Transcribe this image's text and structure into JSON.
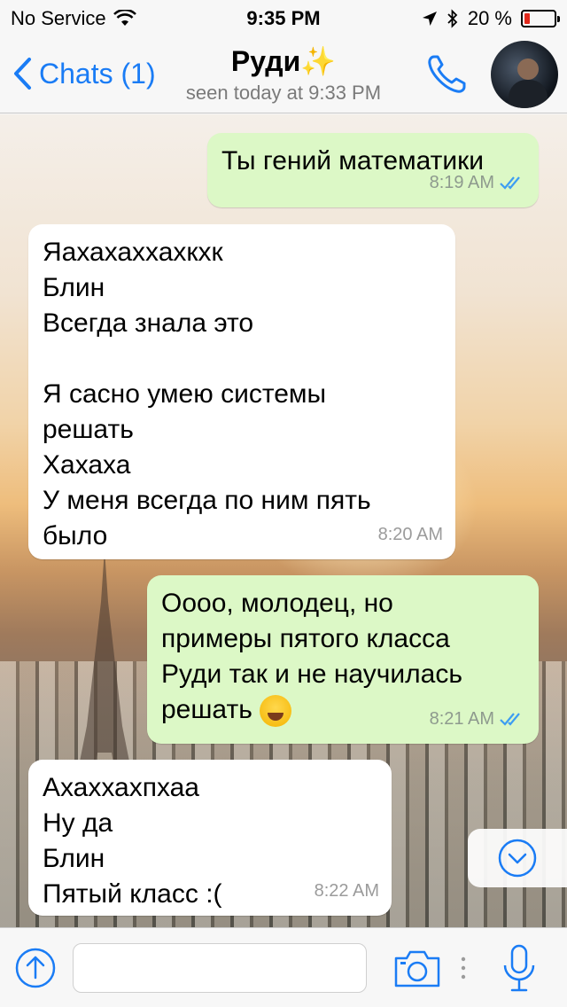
{
  "status_bar": {
    "carrier": "No Service",
    "time": "9:35 PM",
    "battery": "20 %",
    "battery_level": 0.2
  },
  "nav": {
    "back_label": "Chats (1)",
    "contact_name": "Руди✨",
    "last_seen": "seen today at 9:33 PM"
  },
  "messages": [
    {
      "direction": "out",
      "text": "Ты гений математики",
      "time": "8:19 AM",
      "read": true
    },
    {
      "direction": "in",
      "text": "Яахахаххахкхк\nБлин\nВсегда знала это\n\nЯ сасно умею системы\nрешать\nХахаха\nУ меня всегда по ним пять\nбыло",
      "time": "8:20 AM"
    },
    {
      "direction": "out",
      "text": "Оооо, молодец, но\nпримеры пятого класса\nРуди так и не научилась\nрешать",
      "emoji": "face-with-tears-of-joy",
      "time": "8:21 AM",
      "read": true
    },
    {
      "direction": "in",
      "text": "Ахаххахпхаа\nНу да\nБлин\nПятый класс :(",
      "time": "8:22 AM"
    }
  ],
  "input": {
    "placeholder": ""
  },
  "colors": {
    "accent": "#1a7cf5",
    "outgoing_bubble": "#dcf8c6",
    "incoming_bubble": "#ffffff",
    "read_ticks": "#3d9df2",
    "battery_low": "#e0281b"
  }
}
